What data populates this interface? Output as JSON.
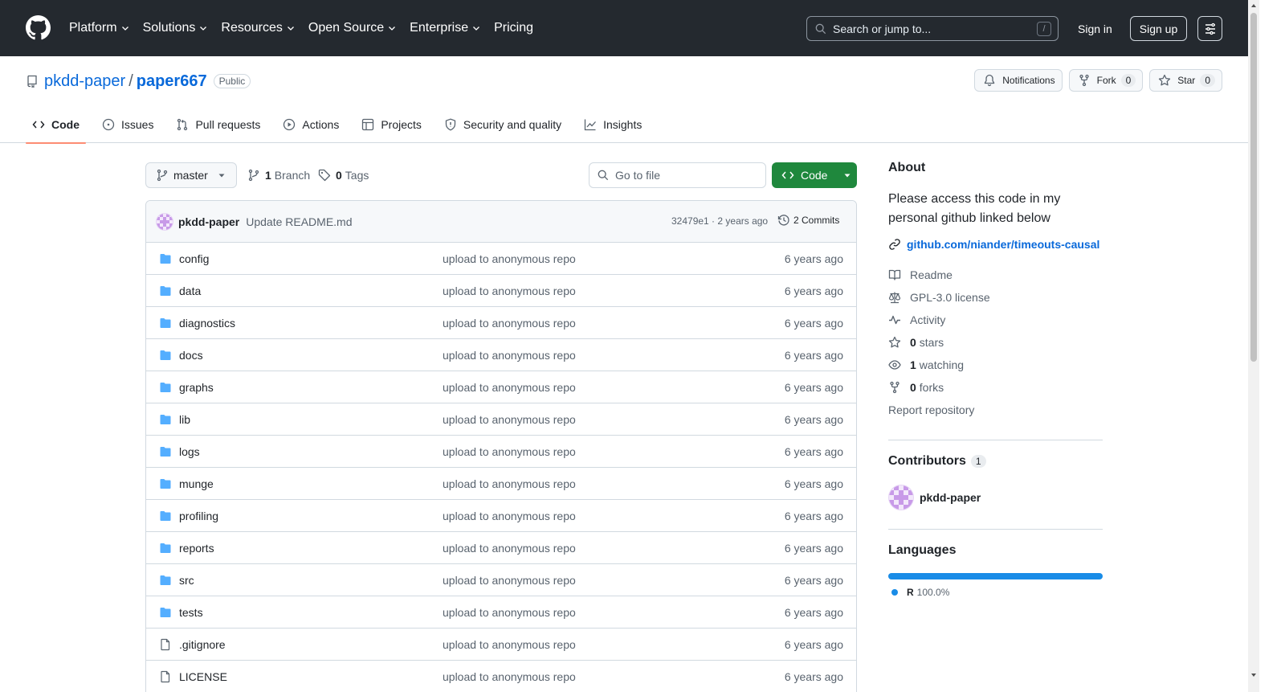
{
  "header": {
    "nav": [
      "Platform",
      "Solutions",
      "Resources",
      "Open Source",
      "Enterprise",
      "Pricing"
    ],
    "search_placeholder": "Search or jump to...",
    "search_shortcut": "/",
    "sign_in": "Sign in",
    "sign_up": "Sign up"
  },
  "repo": {
    "owner": "pkdd-paper",
    "separator": "/",
    "name": "paper667",
    "visibility": "Public",
    "notifications_label": "Notifications",
    "fork_label": "Fork",
    "fork_count": "0",
    "star_label": "Star",
    "star_count": "0"
  },
  "tabs": [
    {
      "label": "Code",
      "icon": "code-icon"
    },
    {
      "label": "Issues",
      "icon": "issue-icon"
    },
    {
      "label": "Pull requests",
      "icon": "pull-request-icon"
    },
    {
      "label": "Actions",
      "icon": "play-icon"
    },
    {
      "label": "Projects",
      "icon": "table-icon"
    },
    {
      "label": "Security and quality",
      "icon": "shield-icon"
    },
    {
      "label": "Insights",
      "icon": "graph-icon"
    }
  ],
  "toolbar": {
    "branch": "master",
    "branch_count": "1",
    "branch_label": "Branch",
    "tag_count": "0",
    "tag_label": "Tags",
    "goto_placeholder": "Go to file",
    "code_label": "Code"
  },
  "commit": {
    "author": "pkdd-paper",
    "message": "Update README.md",
    "sha_time": "32479e1 · 2 years ago",
    "count_label": "2 Commits"
  },
  "files": [
    {
      "name": "config",
      "type": "dir",
      "message": "upload to anonymous repo",
      "time": "6 years ago"
    },
    {
      "name": "data",
      "type": "dir",
      "message": "upload to anonymous repo",
      "time": "6 years ago"
    },
    {
      "name": "diagnostics",
      "type": "dir",
      "message": "upload to anonymous repo",
      "time": "6 years ago"
    },
    {
      "name": "docs",
      "type": "dir",
      "message": "upload to anonymous repo",
      "time": "6 years ago"
    },
    {
      "name": "graphs",
      "type": "dir",
      "message": "upload to anonymous repo",
      "time": "6 years ago"
    },
    {
      "name": "lib",
      "type": "dir",
      "message": "upload to anonymous repo",
      "time": "6 years ago"
    },
    {
      "name": "logs",
      "type": "dir",
      "message": "upload to anonymous repo",
      "time": "6 years ago"
    },
    {
      "name": "munge",
      "type": "dir",
      "message": "upload to anonymous repo",
      "time": "6 years ago"
    },
    {
      "name": "profiling",
      "type": "dir",
      "message": "upload to anonymous repo",
      "time": "6 years ago"
    },
    {
      "name": "reports",
      "type": "dir",
      "message": "upload to anonymous repo",
      "time": "6 years ago"
    },
    {
      "name": "src",
      "type": "dir",
      "message": "upload to anonymous repo",
      "time": "6 years ago"
    },
    {
      "name": "tests",
      "type": "dir",
      "message": "upload to anonymous repo",
      "time": "6 years ago"
    },
    {
      "name": ".gitignore",
      "type": "file",
      "message": "upload to anonymous repo",
      "time": "6 years ago"
    },
    {
      "name": "LICENSE",
      "type": "file",
      "message": "upload to anonymous repo",
      "time": "6 years ago"
    }
  ],
  "about": {
    "title": "About",
    "description": "Please access this code in my personal github linked below",
    "link": "github.com/niander/timeouts-causal",
    "readme": "Readme",
    "license": "GPL-3.0 license",
    "activity": "Activity",
    "stars_count": "0",
    "stars_label": "stars",
    "watching_count": "1",
    "watching_label": "watching",
    "forks_count": "0",
    "forks_label": "forks",
    "report": "Report repository"
  },
  "contributors": {
    "title": "Contributors",
    "count": "1",
    "list": [
      {
        "name": "pkdd-paper"
      }
    ]
  },
  "languages": {
    "title": "Languages",
    "list": [
      {
        "name": "R",
        "percent": "100.0%",
        "fraction": 1.0,
        "color": "#198ce7"
      }
    ]
  },
  "colors": {
    "header_bg": "#24292f",
    "link": "#0969da",
    "primary_button": "#1f883d",
    "folder": "#54aeff",
    "active_tab_underline": "#fd8c73"
  }
}
